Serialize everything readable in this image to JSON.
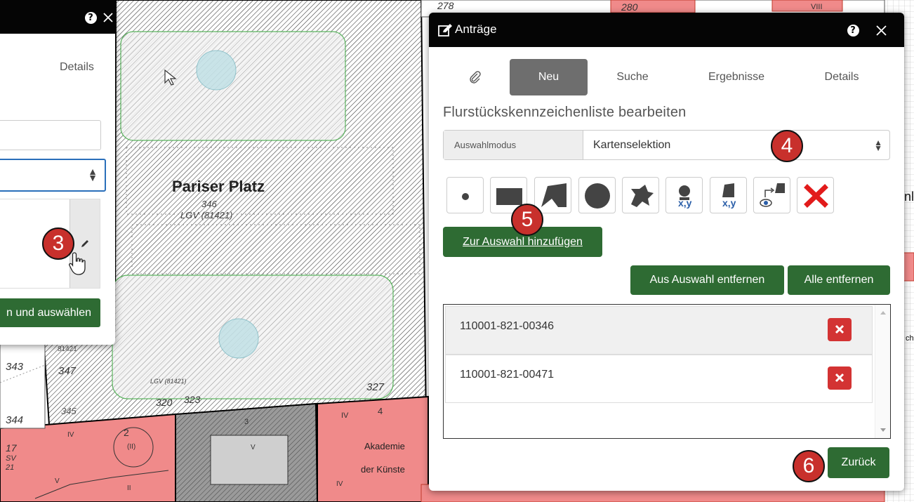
{
  "map": {
    "place_name": "Pariser Platz",
    "parcel_number": "346",
    "parcel_ref": "LGV (81421)",
    "labels_top": [
      "278",
      "280",
      "VIII"
    ],
    "labels_left": [
      "343",
      "347",
      "344",
      "345",
      "81421"
    ],
    "labels_bottom": [
      "320",
      "323",
      "327",
      "2",
      "IV",
      "3",
      "4"
    ],
    "lgv_small": "LGV (81421)",
    "building_name_line1": "Akademie",
    "building_name_line2": "der Künste",
    "building_marks": [
      "(II)",
      "II",
      "V",
      "IV",
      "V",
      "IV"
    ],
    "edge_text": [
      "nl",
      "ch",
      "17",
      "SV",
      "21"
    ]
  },
  "left_panel": {
    "details_tab": "Details",
    "select_button": "n und auswählen"
  },
  "dialog": {
    "title": "Anträge",
    "tabs": [
      {
        "label": "Neu"
      },
      {
        "label": "Suche"
      },
      {
        "label": "Ergebnisse"
      },
      {
        "label": "Details"
      }
    ],
    "heading": "Flurstückskennzeichenliste bearbeiten",
    "mode_label": "Auswahlmodus",
    "mode_value": "Kartenselektion",
    "add_button": "Zur Auswahl hinzufügen",
    "remove_selected_button": "Aus Auswahl entfernen",
    "remove_all_button": "Alle entfernen",
    "results": [
      "110001-821-00346",
      "110001-821-00471"
    ],
    "back_button": "Zurück",
    "tool_xy_label": "x,y"
  },
  "markers": [
    "3",
    "4",
    "5",
    "6"
  ],
  "colors": {
    "header_bg": "#050505",
    "button_green": "#2e6b33",
    "delete_red": "#d33333",
    "marker_red": "#c8302c",
    "active_tab": "#6e6e6e",
    "building_pink": "#f08a8a"
  },
  "icons": [
    "help-icon",
    "close-icon",
    "edit-icon",
    "paperclip-icon",
    "pencil-note-icon",
    "point-icon",
    "rectangle-icon",
    "polygon-icon",
    "circle-icon",
    "freehand-icon",
    "point-xy-icon",
    "polygon-xy-icon",
    "view-selection-icon",
    "clear-selection-icon",
    "remove-icon"
  ]
}
